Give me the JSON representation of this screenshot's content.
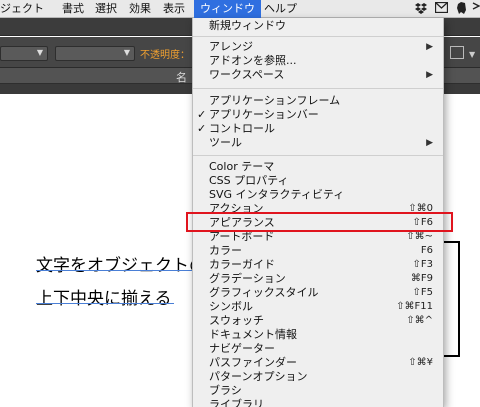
{
  "menubar": {
    "items": [
      {
        "label": "ジェクト"
      },
      {
        "label": "書式"
      },
      {
        "label": "選択"
      },
      {
        "label": "効果"
      },
      {
        "label": "表示"
      },
      {
        "label": "ウィンドウ"
      },
      {
        "label": "ヘルプ"
      }
    ],
    "icons": [
      "dropbox-icon",
      "mail-icon",
      "evernote-icon",
      "sync-icon"
    ]
  },
  "toolbar": {
    "opacity_label": "不透明度："
  },
  "tab": {
    "label": "名"
  },
  "document": {
    "line1": "文字をオブジェクトの",
    "line2": "上下中央に揃える"
  },
  "window_menu": {
    "items": [
      {
        "label": "新規ウィンドウ",
        "shortcut": "",
        "submenu": false,
        "checked": false
      },
      {
        "label": "アレンジ",
        "shortcut": "",
        "submenu": true,
        "checked": false
      },
      {
        "label": "アドオンを参照...",
        "shortcut": "",
        "submenu": false,
        "checked": false
      },
      {
        "label": "ワークスペース",
        "shortcut": "",
        "submenu": true,
        "checked": false
      },
      {
        "label": "アプリケーションフレーム",
        "shortcut": "",
        "submenu": false,
        "checked": false
      },
      {
        "label": "アプリケーションバー",
        "shortcut": "",
        "submenu": false,
        "checked": true
      },
      {
        "label": "コントロール",
        "shortcut": "",
        "submenu": false,
        "checked": true
      },
      {
        "label": "ツール",
        "shortcut": "",
        "submenu": true,
        "checked": false
      },
      {
        "label": "Color テーマ",
        "shortcut": "",
        "submenu": false,
        "checked": false
      },
      {
        "label": "CSS プロパティ",
        "shortcut": "",
        "submenu": false,
        "checked": false
      },
      {
        "label": "SVG インタラクティビティ",
        "shortcut": "",
        "submenu": false,
        "checked": false
      },
      {
        "label": "アクション",
        "shortcut": "⇧⌘0",
        "submenu": false,
        "checked": false
      },
      {
        "label": "アピアランス",
        "shortcut": "⇧F6",
        "submenu": false,
        "checked": false
      },
      {
        "label": "アートボード",
        "shortcut": "⇧⌘~",
        "submenu": false,
        "checked": false
      },
      {
        "label": "カラー",
        "shortcut": "F6",
        "submenu": false,
        "checked": false
      },
      {
        "label": "カラーガイド",
        "shortcut": "⇧F3",
        "submenu": false,
        "checked": false
      },
      {
        "label": "グラデーション",
        "shortcut": "⌘F9",
        "submenu": false,
        "checked": false
      },
      {
        "label": "グラフィックスタイル",
        "shortcut": "⇧F5",
        "submenu": false,
        "checked": false
      },
      {
        "label": "シンボル",
        "shortcut": "⇧⌘F11",
        "submenu": false,
        "checked": false
      },
      {
        "label": "スウォッチ",
        "shortcut": "⇧⌘^",
        "submenu": false,
        "checked": false
      },
      {
        "label": "ドキュメント情報",
        "shortcut": "",
        "submenu": false,
        "checked": false
      },
      {
        "label": "ナビゲーター",
        "shortcut": "",
        "submenu": false,
        "checked": false
      },
      {
        "label": "パスファインダー",
        "shortcut": "⇧⌘¥",
        "submenu": false,
        "checked": false
      },
      {
        "label": "パターンオプション",
        "shortcut": "",
        "submenu": false,
        "checked": false
      },
      {
        "label": "ブラシ",
        "shortcut": "",
        "submenu": false,
        "checked": false
      },
      {
        "label": "ライブラリ",
        "shortcut": "",
        "submenu": false,
        "checked": false
      }
    ],
    "check_glyph": "✓",
    "submenu_glyph": "▶",
    "highlighted_item": "アピアランス"
  },
  "colors": {
    "menu_highlight": "#2f6fe0",
    "annotation_red": "#e0141e",
    "opacity_label": "#f0a030"
  }
}
